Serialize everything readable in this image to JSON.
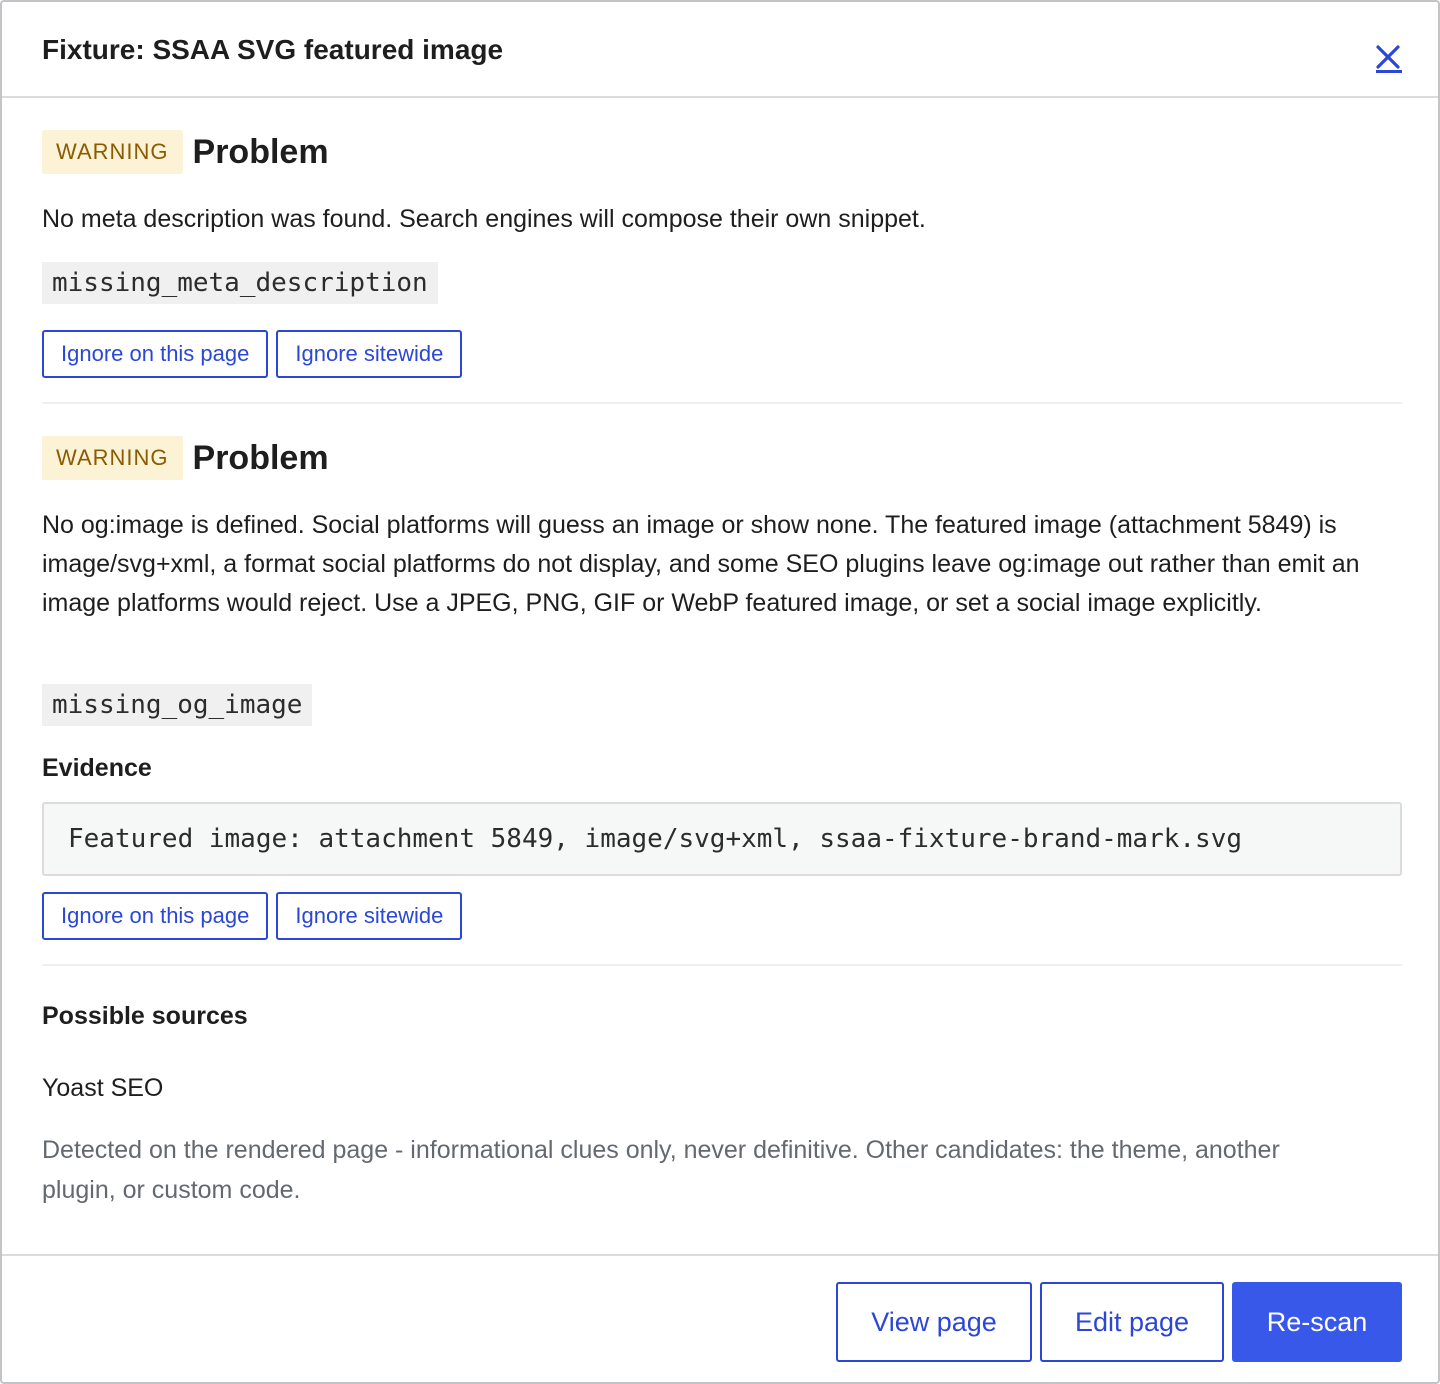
{
  "modal": {
    "title": "Fixture: SSAA SVG featured image",
    "close_icon": "close-x-icon"
  },
  "issues": [
    {
      "severity": "WARNING",
      "title": "Problem",
      "description": "No meta description was found. Search engines will compose their own snippet.",
      "code": "missing_meta_description",
      "actions": {
        "ignore_page": "Ignore on this page",
        "ignore_sitewide": "Ignore sitewide"
      }
    },
    {
      "severity": "WARNING",
      "title": "Problem",
      "description": "No og:image is defined. Social platforms will guess an image or show none. The featured image (attachment 5849) is image/svg+xml, a format social platforms do not display, and some SEO plugins leave og:image out rather than emit an image platforms would reject. Use a JPEG, PNG, GIF or WebP featured image, or set a social image explicitly.",
      "code": "missing_og_image",
      "evidence_label": "Evidence",
      "evidence": "Featured image: attachment 5849, image/svg+xml, ssaa-fixture-brand-mark.svg",
      "actions": {
        "ignore_page": "Ignore on this page",
        "ignore_sitewide": "Ignore sitewide"
      }
    }
  ],
  "sources": {
    "title": "Possible sources",
    "items": [
      "Yoast SEO"
    ],
    "note": "Detected on the rendered page - informational clues only, never definitive. Other candidates: the theme, another plugin, or custom code."
  },
  "footer": {
    "view_page": "View page",
    "edit_page": "Edit page",
    "rescan": "Re-scan"
  },
  "colors": {
    "accent": "#3858e9",
    "link": "#2b47d6",
    "warning_bg": "#fcf3d6",
    "warning_text": "#8a5b00"
  }
}
